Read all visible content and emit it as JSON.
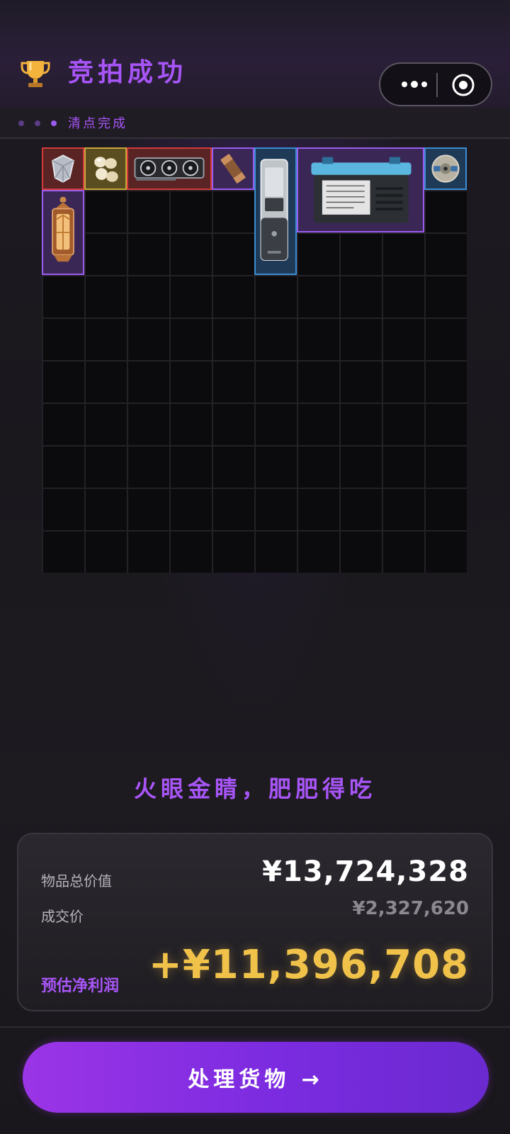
{
  "header": {
    "title": "竞拍成功",
    "trophy_icon": "trophy-icon",
    "more_icon": "more-dots-icon",
    "target_icon": "target-circle-icon"
  },
  "status": {
    "text": "清点完成"
  },
  "inventory": {
    "items": [
      {
        "name": "diamond",
        "rarity": "red",
        "color": "#d33b3b"
      },
      {
        "name": "pearls",
        "rarity": "gold",
        "color": "#c7a83b"
      },
      {
        "name": "graphics-card",
        "rarity": "red",
        "color": "#d33b3b"
      },
      {
        "name": "chocolate-bar",
        "rarity": "purple",
        "color": "#9b5cf0"
      },
      {
        "name": "power-bank",
        "rarity": "blue",
        "color": "#3b8dd3"
      },
      {
        "name": "car-battery",
        "rarity": "purple",
        "color": "#9b5cf0"
      },
      {
        "name": "disc",
        "rarity": "blue",
        "color": "#3b8dd3"
      },
      {
        "name": "lantern",
        "rarity": "purple",
        "color": "#9b5cf0"
      }
    ]
  },
  "slogan": "火眼金睛，肥肥得吃",
  "summary": {
    "total_label": "物品总价值",
    "total_value": "¥13,724,328",
    "deal_label": "成交价",
    "deal_value": "¥2,327,620",
    "profit_label": "预估净利润",
    "profit_value": "+¥11,396,708"
  },
  "cta": {
    "label": "处理货物 →"
  },
  "colors": {
    "accent": "#a855f7",
    "profit": "#f0c24a"
  }
}
